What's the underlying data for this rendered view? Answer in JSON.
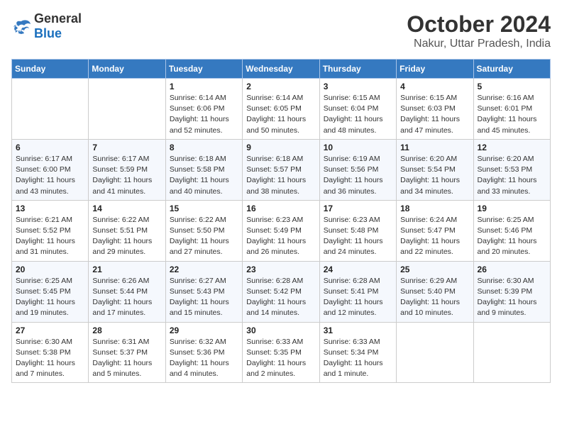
{
  "logo": {
    "general": "General",
    "blue": "Blue"
  },
  "header": {
    "month": "October 2024",
    "location": "Nakur, Uttar Pradesh, India"
  },
  "weekdays": [
    "Sunday",
    "Monday",
    "Tuesday",
    "Wednesday",
    "Thursday",
    "Friday",
    "Saturday"
  ],
  "weeks": [
    [
      {
        "day": "",
        "info": ""
      },
      {
        "day": "",
        "info": ""
      },
      {
        "day": "1",
        "info": "Sunrise: 6:14 AM\nSunset: 6:06 PM\nDaylight: 11 hours and 52 minutes."
      },
      {
        "day": "2",
        "info": "Sunrise: 6:14 AM\nSunset: 6:05 PM\nDaylight: 11 hours and 50 minutes."
      },
      {
        "day": "3",
        "info": "Sunrise: 6:15 AM\nSunset: 6:04 PM\nDaylight: 11 hours and 48 minutes."
      },
      {
        "day": "4",
        "info": "Sunrise: 6:15 AM\nSunset: 6:03 PM\nDaylight: 11 hours and 47 minutes."
      },
      {
        "day": "5",
        "info": "Sunrise: 6:16 AM\nSunset: 6:01 PM\nDaylight: 11 hours and 45 minutes."
      }
    ],
    [
      {
        "day": "6",
        "info": "Sunrise: 6:17 AM\nSunset: 6:00 PM\nDaylight: 11 hours and 43 minutes."
      },
      {
        "day": "7",
        "info": "Sunrise: 6:17 AM\nSunset: 5:59 PM\nDaylight: 11 hours and 41 minutes."
      },
      {
        "day": "8",
        "info": "Sunrise: 6:18 AM\nSunset: 5:58 PM\nDaylight: 11 hours and 40 minutes."
      },
      {
        "day": "9",
        "info": "Sunrise: 6:18 AM\nSunset: 5:57 PM\nDaylight: 11 hours and 38 minutes."
      },
      {
        "day": "10",
        "info": "Sunrise: 6:19 AM\nSunset: 5:56 PM\nDaylight: 11 hours and 36 minutes."
      },
      {
        "day": "11",
        "info": "Sunrise: 6:20 AM\nSunset: 5:54 PM\nDaylight: 11 hours and 34 minutes."
      },
      {
        "day": "12",
        "info": "Sunrise: 6:20 AM\nSunset: 5:53 PM\nDaylight: 11 hours and 33 minutes."
      }
    ],
    [
      {
        "day": "13",
        "info": "Sunrise: 6:21 AM\nSunset: 5:52 PM\nDaylight: 11 hours and 31 minutes."
      },
      {
        "day": "14",
        "info": "Sunrise: 6:22 AM\nSunset: 5:51 PM\nDaylight: 11 hours and 29 minutes."
      },
      {
        "day": "15",
        "info": "Sunrise: 6:22 AM\nSunset: 5:50 PM\nDaylight: 11 hours and 27 minutes."
      },
      {
        "day": "16",
        "info": "Sunrise: 6:23 AM\nSunset: 5:49 PM\nDaylight: 11 hours and 26 minutes."
      },
      {
        "day": "17",
        "info": "Sunrise: 6:23 AM\nSunset: 5:48 PM\nDaylight: 11 hours and 24 minutes."
      },
      {
        "day": "18",
        "info": "Sunrise: 6:24 AM\nSunset: 5:47 PM\nDaylight: 11 hours and 22 minutes."
      },
      {
        "day": "19",
        "info": "Sunrise: 6:25 AM\nSunset: 5:46 PM\nDaylight: 11 hours and 20 minutes."
      }
    ],
    [
      {
        "day": "20",
        "info": "Sunrise: 6:25 AM\nSunset: 5:45 PM\nDaylight: 11 hours and 19 minutes."
      },
      {
        "day": "21",
        "info": "Sunrise: 6:26 AM\nSunset: 5:44 PM\nDaylight: 11 hours and 17 minutes."
      },
      {
        "day": "22",
        "info": "Sunrise: 6:27 AM\nSunset: 5:43 PM\nDaylight: 11 hours and 15 minutes."
      },
      {
        "day": "23",
        "info": "Sunrise: 6:28 AM\nSunset: 5:42 PM\nDaylight: 11 hours and 14 minutes."
      },
      {
        "day": "24",
        "info": "Sunrise: 6:28 AM\nSunset: 5:41 PM\nDaylight: 11 hours and 12 minutes."
      },
      {
        "day": "25",
        "info": "Sunrise: 6:29 AM\nSunset: 5:40 PM\nDaylight: 11 hours and 10 minutes."
      },
      {
        "day": "26",
        "info": "Sunrise: 6:30 AM\nSunset: 5:39 PM\nDaylight: 11 hours and 9 minutes."
      }
    ],
    [
      {
        "day": "27",
        "info": "Sunrise: 6:30 AM\nSunset: 5:38 PM\nDaylight: 11 hours and 7 minutes."
      },
      {
        "day": "28",
        "info": "Sunrise: 6:31 AM\nSunset: 5:37 PM\nDaylight: 11 hours and 5 minutes."
      },
      {
        "day": "29",
        "info": "Sunrise: 6:32 AM\nSunset: 5:36 PM\nDaylight: 11 hours and 4 minutes."
      },
      {
        "day": "30",
        "info": "Sunrise: 6:33 AM\nSunset: 5:35 PM\nDaylight: 11 hours and 2 minutes."
      },
      {
        "day": "31",
        "info": "Sunrise: 6:33 AM\nSunset: 5:34 PM\nDaylight: 11 hours and 1 minute."
      },
      {
        "day": "",
        "info": ""
      },
      {
        "day": "",
        "info": ""
      }
    ]
  ]
}
